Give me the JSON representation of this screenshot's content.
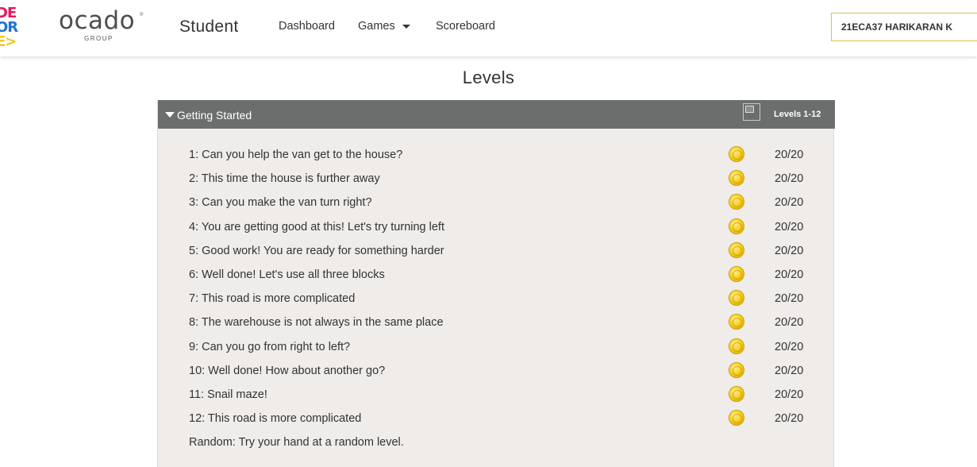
{
  "header": {
    "cfl_logo_rows": [
      "DE",
      "OR",
      "E>"
    ],
    "cfl_colors": [
      "#e6195f",
      "#1e73d2",
      "#f5c518"
    ],
    "brand_word": "ocado",
    "brand_reg": "®",
    "brand_sub": "GROUP",
    "role": "Student",
    "nav": {
      "dashboard": "Dashboard",
      "games": "Games",
      "scoreboard": "Scoreboard"
    },
    "user": "21ECA37 HARIKARAN K"
  },
  "page": {
    "title": "Levels"
  },
  "episode": {
    "title": "Getting Started",
    "range": "Levels 1-12",
    "icon": "broken-image-icon",
    "coin_icon": "gold-coin-icon",
    "levels": [
      {
        "name": "1: Can you help the van get to the house?",
        "score": "20/20"
      },
      {
        "name": "2: This time the house is further away",
        "score": "20/20"
      },
      {
        "name": "3: Can you make the van turn right?",
        "score": "20/20"
      },
      {
        "name": "4: You are getting good at this! Let's try turning left",
        "score": "20/20"
      },
      {
        "name": "5: Good work! You are ready for something harder",
        "score": "20/20"
      },
      {
        "name": "6: Well done! Let's use all three blocks",
        "score": "20/20"
      },
      {
        "name": "7: This road is more complicated",
        "score": "20/20"
      },
      {
        "name": "8: The warehouse is not always in the same place",
        "score": "20/20"
      },
      {
        "name": "9: Can you go from right to left?",
        "score": "20/20"
      },
      {
        "name": "10: Well done! How about another go?",
        "score": "20/20"
      },
      {
        "name": "11: Snail maze!",
        "score": "20/20"
      },
      {
        "name": "12: This road is more complicated",
        "score": "20/20"
      }
    ],
    "random": "Random: Try your hand at a random level."
  }
}
